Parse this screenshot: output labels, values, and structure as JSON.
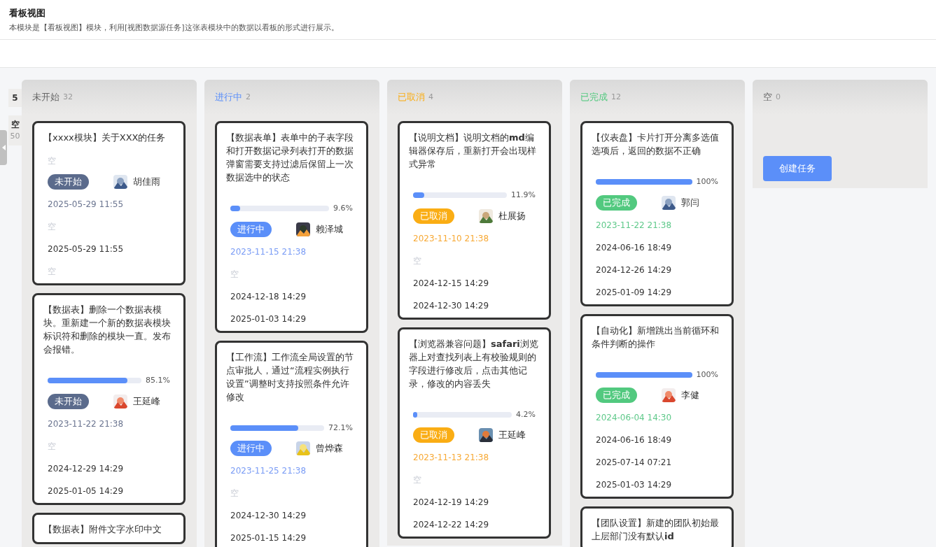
{
  "header": {
    "title": "看板视图",
    "description": "本模块是【看板视图】模块，利用[视图数据源任务]这张表模块中的数据以看板的形式进行展示。"
  },
  "side_tabs": [
    {
      "label": "5"
    },
    {
      "label": "空",
      "count": "50"
    }
  ],
  "columns": [
    {
      "title": "未开始",
      "count": "32",
      "kind": "not_started",
      "cards": [
        {
          "title": "【xxxx模块】关于XXX的任务",
          "status": {
            "label": "未开始",
            "kind": "not_started"
          },
          "assignee": "胡佳雨",
          "before": [
            {
              "kind": "empty",
              "text": "空"
            }
          ],
          "fields": [
            {
              "kind": "status_date",
              "text": "2025-05-29 11:55"
            },
            {
              "kind": "empty",
              "text": "空"
            },
            {
              "kind": "date",
              "text": "2025-05-29 11:55"
            },
            {
              "kind": "empty",
              "text": "空"
            }
          ]
        },
        {
          "title": "【数据表】删除一个数据表模块。重新建一个新的数据表模块标识符和删除的模块一直。发布会报错。",
          "progress": {
            "level": 0.851,
            "label": "85.1%"
          },
          "status": {
            "label": "未开始",
            "kind": "not_started"
          },
          "assignee": "王延峰",
          "fields": [
            {
              "kind": "status_date",
              "text": "2023-11-22 21:38"
            },
            {
              "kind": "empty",
              "text": "空"
            },
            {
              "kind": "date",
              "text": "2024-12-29 14:29"
            },
            {
              "kind": "date",
              "text": "2025-01-05 14:29"
            }
          ]
        },
        {
          "title": "【数据表】附件文字水印中文"
        }
      ]
    },
    {
      "title": "进行中",
      "count": "2",
      "kind": "in_progress",
      "cards": [
        {
          "title": "【数据表单】表单中的子表字段和打开数据记录列表打开的数据弹窗需要支持过滤后保留上一次数据选中的状态",
          "progress": {
            "level": 0.096,
            "label": "9.6%"
          },
          "status": {
            "label": "进行中",
            "kind": "in_progress"
          },
          "assignee": "赖泽城",
          "fields": [
            {
              "kind": "status_date",
              "text": "2023-11-15 21:38"
            },
            {
              "kind": "empty",
              "text": "空"
            },
            {
              "kind": "date",
              "text": "2024-12-18 14:29"
            },
            {
              "kind": "date",
              "text": "2025-01-03 14:29"
            }
          ]
        },
        {
          "title": "【工作流】工作流全局设置的节点审批人，通过“流程实例执行设置”调整时支持按照条件允许修改",
          "progress": {
            "level": 0.721,
            "label": "72.1%"
          },
          "status": {
            "label": "进行中",
            "kind": "in_progress"
          },
          "assignee": "曾烨森",
          "fields": [
            {
              "kind": "status_date",
              "text": "2023-11-25 21:38"
            },
            {
              "kind": "empty",
              "text": "空"
            },
            {
              "kind": "date",
              "text": "2024-12-30 14:29"
            },
            {
              "kind": "date",
              "text": "2025-01-15 14:29"
            }
          ]
        }
      ]
    },
    {
      "title": "已取消",
      "count": "4",
      "kind": "cancelled",
      "cards": [
        {
          "title": "【说明文档】说明文档的**md**编辑器保存后，重新打开会出现样式异常",
          "progress": {
            "level": 0.119,
            "label": "11.9%"
          },
          "status": {
            "label": "已取消",
            "kind": "cancelled"
          },
          "assignee": "杜展扬",
          "fields": [
            {
              "kind": "status_date",
              "text": "2023-11-10 21:38"
            },
            {
              "kind": "empty",
              "text": "空"
            },
            {
              "kind": "date",
              "text": "2024-12-15 14:29"
            },
            {
              "kind": "date",
              "text": "2024-12-30 14:29"
            }
          ]
        },
        {
          "title": "【浏览器兼容问题】**safari**浏览器上对查找列表上有校验规则的字段进行修改后，点击其他记录，修改的内容丢失",
          "progress": {
            "level": 0.042,
            "label": "4.2%"
          },
          "status": {
            "label": "已取消",
            "kind": "cancelled"
          },
          "assignee": "王延峰",
          "fields": [
            {
              "kind": "status_date",
              "text": "2023-11-13 21:38"
            },
            {
              "kind": "empty",
              "text": "空"
            },
            {
              "kind": "date",
              "text": "2024-12-19 14:29"
            },
            {
              "kind": "date",
              "text": "2024-12-22 14:29"
            }
          ]
        }
      ]
    },
    {
      "title": "已完成",
      "count": "12",
      "kind": "done",
      "cards": [
        {
          "title": "【仪表盘】卡片打开分离多选值选项后，返回的数据不正确",
          "progress": {
            "level": 1,
            "label": "100%"
          },
          "status": {
            "label": "已完成",
            "kind": "done"
          },
          "assignee": "郭闫",
          "fields": [
            {
              "kind": "status_date",
              "text": "2023-11-22 21:38"
            },
            {
              "kind": "date",
              "text": "2024-06-16 18:49"
            },
            {
              "kind": "date",
              "text": "2024-12-26 14:29"
            },
            {
              "kind": "date",
              "text": "2025-01-09 14:29"
            }
          ]
        },
        {
          "title": "【自动化】新增跳出当前循环和条件判断的操作",
          "progress": {
            "level": 1,
            "label": "100%"
          },
          "status": {
            "label": "已完成",
            "kind": "done"
          },
          "assignee": "李健",
          "fields": [
            {
              "kind": "status_date",
              "text": "2024-06-04 14:30"
            },
            {
              "kind": "date",
              "text": "2024-06-16 18:49"
            },
            {
              "kind": "date",
              "text": "2025-07-14 07:21"
            },
            {
              "kind": "date",
              "text": "2025-01-03 14:29"
            }
          ]
        },
        {
          "title": "【团队设置】新建的团队初始最上层部门没有默认**id**"
        }
      ]
    },
    {
      "title": "空",
      "count": "0",
      "kind": "empty",
      "button": "创建任务"
    }
  ]
}
